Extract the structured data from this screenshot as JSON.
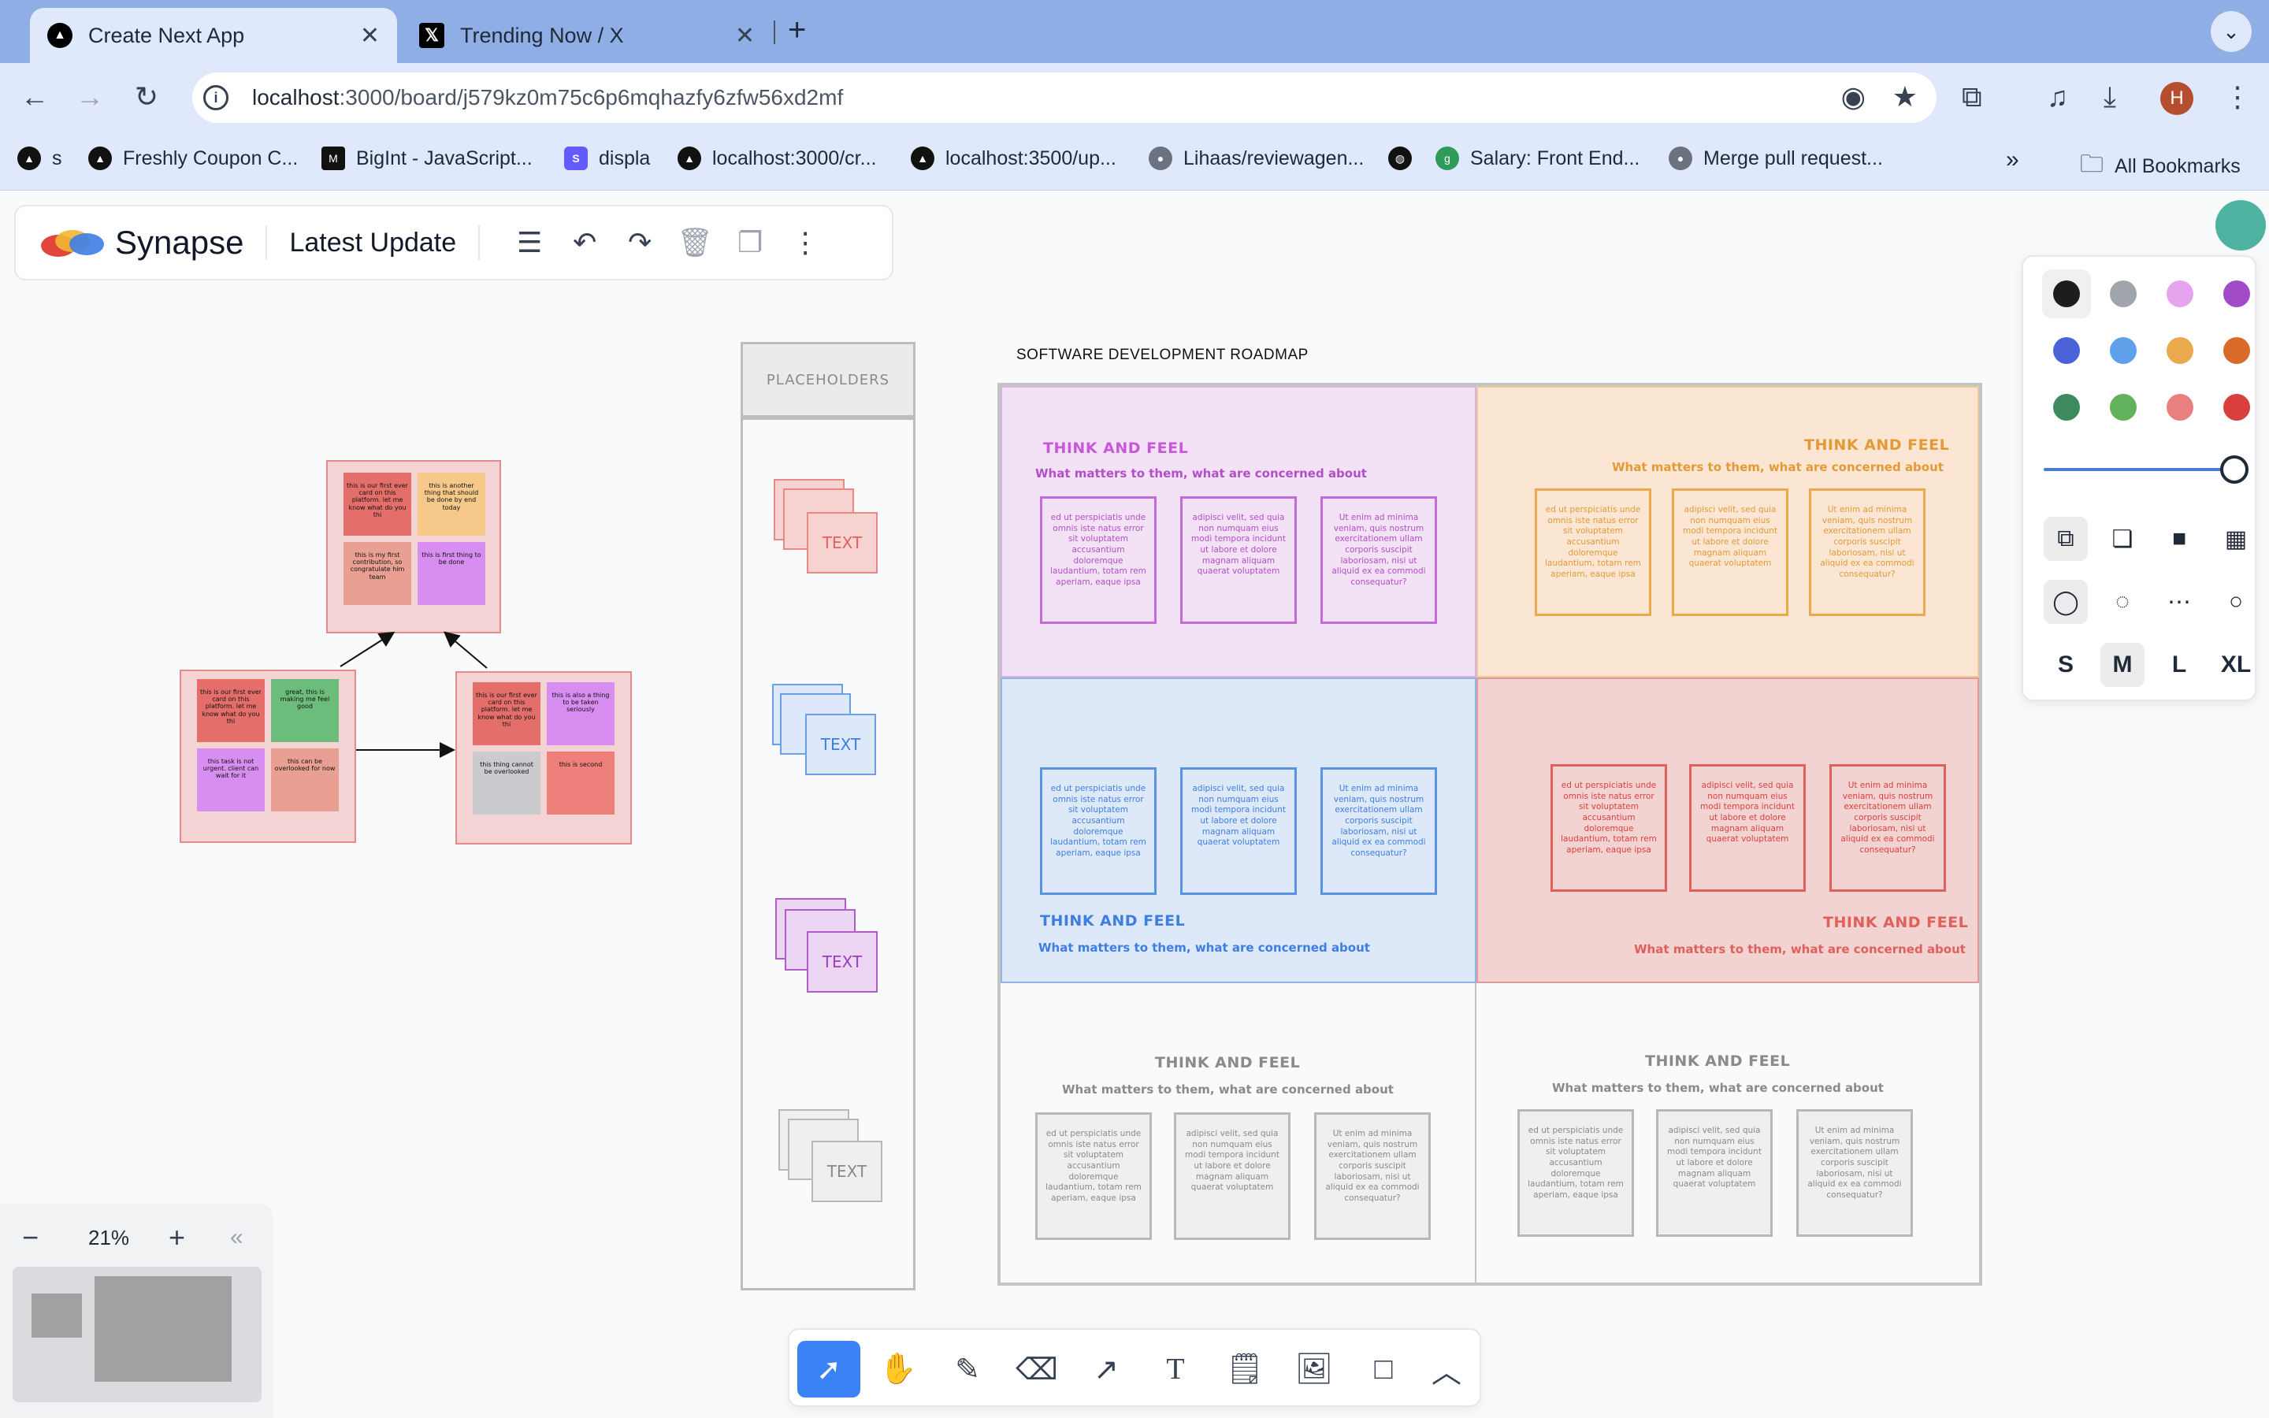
{
  "browser": {
    "tabs": [
      {
        "title": "Create Next App",
        "active": true
      },
      {
        "title": "Trending Now / X",
        "active": false
      }
    ],
    "url_host": "localhost",
    "url_rest": ":3000/board/j579kz0m75c6p6mqhazfy6zfw56xd2mf",
    "profile_initial": "H",
    "bookmarks": [
      "s",
      "Freshly Coupon C...",
      "BigInt - JavaScript...",
      "displa",
      "localhost:3000/cr...",
      "localhost:3500/up...",
      "Lihaas/reviewagen...",
      "",
      "Salary: Front End...",
      "Merge pull request..."
    ],
    "all_bookmarks": "All Bookmarks",
    "bookmarks_overflow": "»"
  },
  "app": {
    "brand": "Synapse",
    "board_title": "Latest Update",
    "zoom_level": "21%",
    "size_options": [
      "S",
      "M",
      "L",
      "XL"
    ],
    "selected_size": "M",
    "colors": [
      "#1f1f1f",
      "#a0a4ab",
      "#e7a4ee",
      "#a24bc8",
      "#4a63d8",
      "#5ea1ea",
      "#e9a94c",
      "#d96b2a",
      "#3d8a5e",
      "#62b25c",
      "#e98080",
      "#d9403d"
    ]
  },
  "canvas": {
    "diagram": {
      "top_notes": [
        "this is our first ever card on this platform. let me know what do you thi",
        "this is another thing that should be done by end today",
        "this is my first contribution, so congratulate him team",
        "this is first thing to be done"
      ],
      "left_notes": [
        "this is our first ever card on this platform. let me know what do you thi",
        "great, this is making me feel good",
        "this task is not urgent. client can wait for it",
        "this can be overlooked for now"
      ],
      "right_notes": [
        "this is our first ever card on this platform. let me know what do you thi",
        "this is also a thing to be taken seriously",
        "this thing cannot be overlooked",
        "this is second"
      ]
    },
    "placeholders": {
      "header": "PLACEHOLDERS",
      "items": [
        "TEXT",
        "TEXT",
        "TEXT",
        "TEXT"
      ]
    },
    "roadmap": {
      "title": "SOFTWARE DEVELOPMENT ROADMAP",
      "cell_title": "THINK AND FEEL",
      "cell_subtitle": "What matters to them, what are concerned about",
      "box_texts": [
        "ed ut perspiciatis unde omnis iste natus error sit voluptatem accusantium doloremque laudantium, totam rem aperiam, eaque ipsa",
        "adipisci velit, sed quia non numquam eius modi tempora incidunt ut labore et dolore magnam aliquam quaerat voluptatem",
        "Ut enim ad minima veniam, quis nostrum exercitationem ullam corporis suscipit laboriosam, nisi ut aliquid ex ea commodi consequatur?"
      ]
    }
  }
}
